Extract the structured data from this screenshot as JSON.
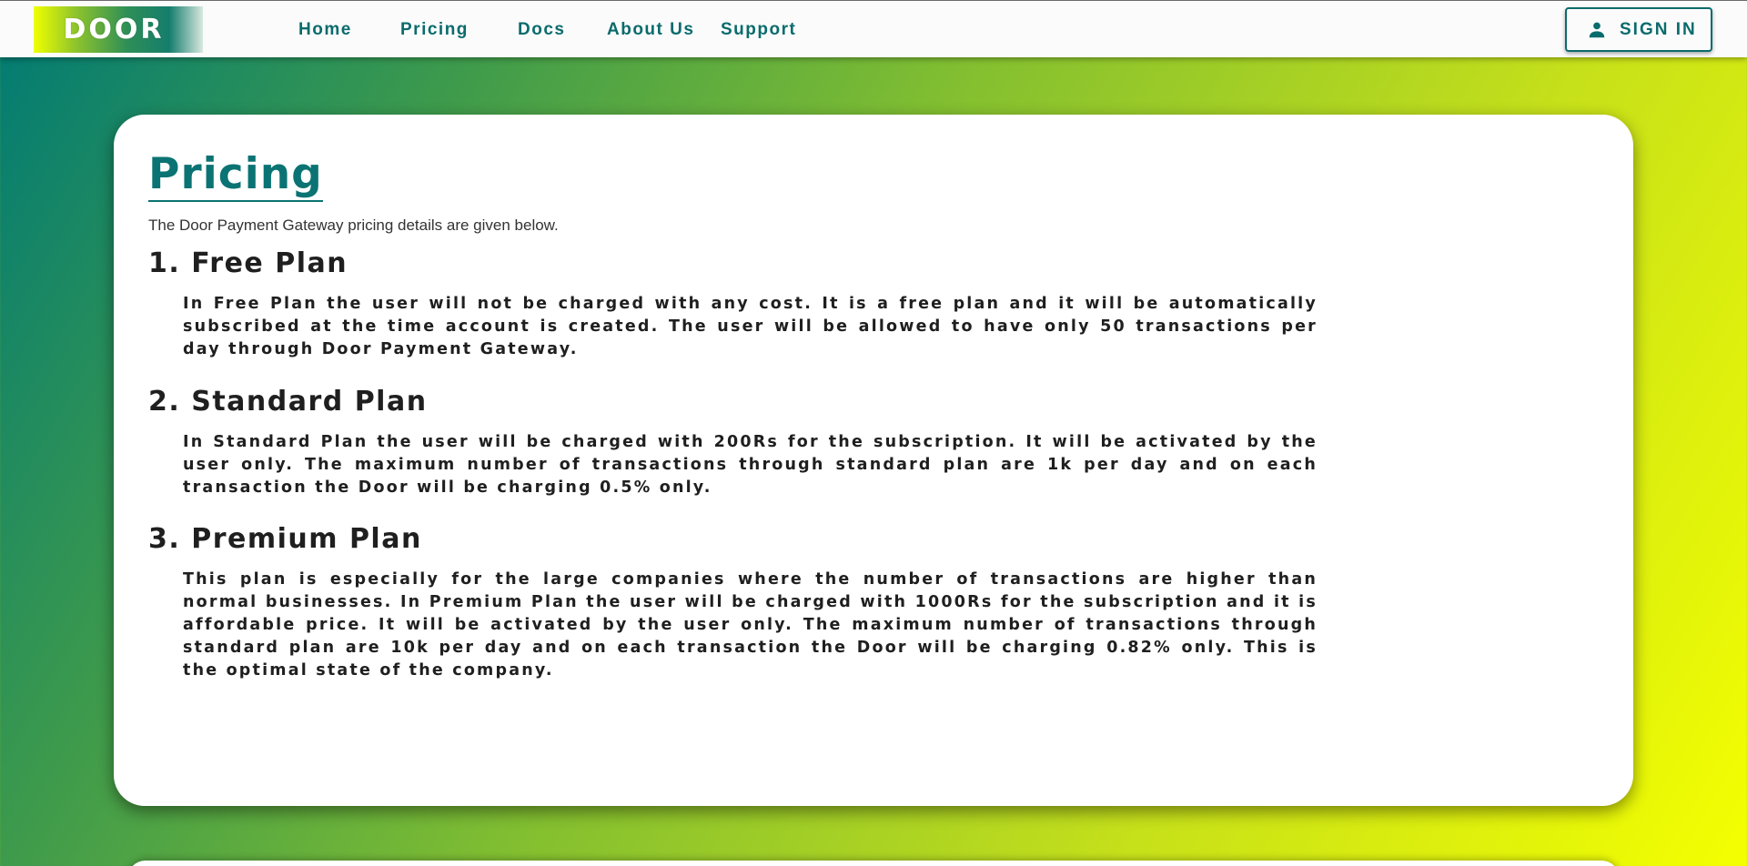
{
  "brand": {
    "logo_text": "DOOR"
  },
  "nav": {
    "items": [
      {
        "label": "Home"
      },
      {
        "label": "Pricing"
      },
      {
        "label": "Docs"
      },
      {
        "label": "About Us"
      },
      {
        "label": "Support"
      }
    ],
    "signin_label": "SIGN IN",
    "signin_icon": "person-icon"
  },
  "page": {
    "title": "Pricing",
    "intro": "The Door Payment Gateway pricing details are given below.",
    "plans": [
      {
        "title": "1. Free Plan",
        "text": "In Free Plan the user will not be charged with any cost. It is a free plan and it will be automatically subscribed at the time account is created. The user will be allowed to have only 50 transactions per day through Door Payment Gateway."
      },
      {
        "title": "2. Standard Plan",
        "text": "In Standard Plan the user will be charged with 200Rs for the subscription. It will be activated by the user only. The maximum number of transactions through standard plan are 1k per day and on each transaction the Door will be charging 0.5% only."
      },
      {
        "title": "3. Premium Plan",
        "text": "This plan is especially for the large companies where the number of transactions are higher than normal businesses. In Premium Plan the user will be charged with 1000Rs for the subscription and it is affordable price. It will be activated by the user only. The maximum number of transactions through standard plan are 10k per day and on each transaction the Door will be charging 0.82% only. This is the optimal state of the company."
      }
    ]
  },
  "colors": {
    "accent": "#0b6b6c",
    "gradient_start": "#007a75",
    "gradient_end": "#f4ff00"
  }
}
